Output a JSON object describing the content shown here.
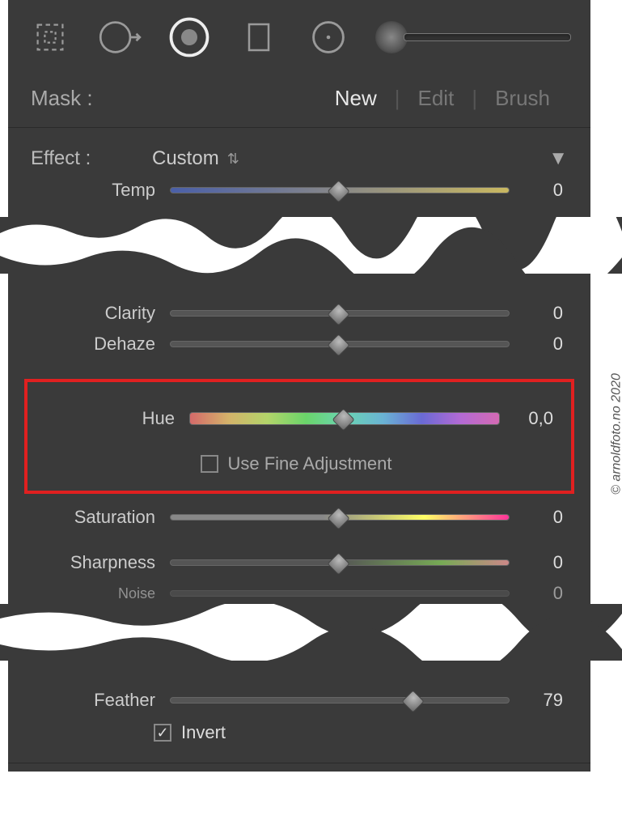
{
  "toolbar": {
    "tools": [
      "crop-icon",
      "circle-arrow-icon",
      "radial-icon",
      "rectangle-icon",
      "ellipse-icon",
      "brush-icon"
    ]
  },
  "mask": {
    "label": "Mask :",
    "options": {
      "new": "New",
      "edit": "Edit",
      "brush": "Brush"
    },
    "active": "new"
  },
  "effect": {
    "label": "Effect :",
    "value": "Custom"
  },
  "sliders": {
    "temp": {
      "label": "Temp",
      "value": "0",
      "pos": 50
    },
    "clarity": {
      "label": "Clarity",
      "value": "0",
      "pos": 50
    },
    "dehaze": {
      "label": "Dehaze",
      "value": "0",
      "pos": 50
    },
    "hue": {
      "label": "Hue",
      "value": "0,0",
      "pos": 50
    },
    "saturation": {
      "label": "Saturation",
      "value": "0",
      "pos": 50
    },
    "sharpness": {
      "label": "Sharpness",
      "value": "0",
      "pos": 50
    },
    "noise": {
      "label": "Noise",
      "value": "0",
      "pos": 50
    },
    "feather": {
      "label": "Feather",
      "value": "79",
      "pos": 72
    }
  },
  "fine_adjust": {
    "label": "Use Fine Adjustment",
    "checked": false
  },
  "invert": {
    "label": "Invert",
    "checked": true
  },
  "copyright": "© arnoldfoto.no 2020"
}
